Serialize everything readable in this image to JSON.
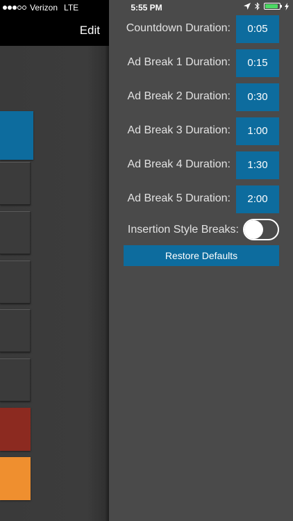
{
  "status_bar": {
    "carrier": "Verizon",
    "network": "LTE",
    "time": "5:55 PM",
    "signal_bars_filled": 3,
    "signal_bars_total": 5,
    "battery_level": 0.9,
    "icons": [
      "location-arrow-icon",
      "bluetooth-icon",
      "battery-icon",
      "charging-bolt-icon"
    ]
  },
  "main_view": {
    "edit_label": "Edit",
    "tile_colors": [
      "#0d6c9e",
      "#3b3b3b",
      "#3b3b3b",
      "#3b3b3b",
      "#3b3b3b",
      "#3b3b3b",
      "#8c2a20",
      "#ef8f2f"
    ]
  },
  "settings": {
    "rows": [
      {
        "label": "Countdown Duration:",
        "value": "0:05"
      },
      {
        "label": "Ad Break 1 Duration:",
        "value": "0:15"
      },
      {
        "label": "Ad Break 2 Duration:",
        "value": "0:30"
      },
      {
        "label": "Ad Break 3 Duration:",
        "value": "1:00"
      },
      {
        "label": "Ad Break 4 Duration:",
        "value": "1:30"
      },
      {
        "label": "Ad Break 5 Duration:",
        "value": "2:00"
      }
    ],
    "insertion_label": "Insertion Style Breaks:",
    "insertion_enabled": false,
    "restore_label": "Restore Defaults"
  },
  "colors": {
    "accent": "#0d6c9e",
    "panel_background": "#4a4a4a",
    "battery_green": "#4cd964"
  }
}
